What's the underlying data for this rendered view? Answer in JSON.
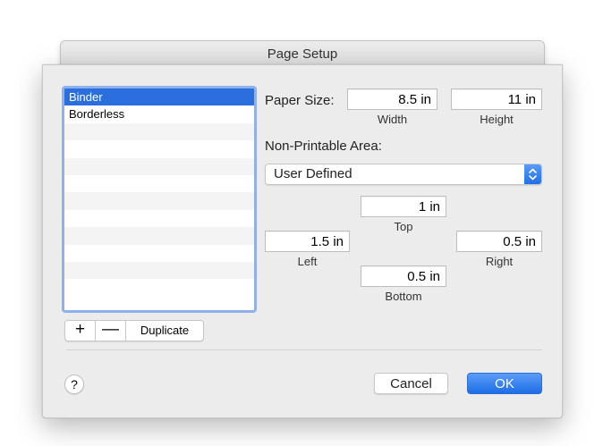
{
  "window": {
    "title": "Page Setup"
  },
  "list": {
    "items": [
      "Binder",
      "Borderless"
    ],
    "selected": "Binder"
  },
  "list_buttons": {
    "add": "+",
    "remove": "—",
    "duplicate": "Duplicate"
  },
  "paper_size": {
    "label": "Paper Size:",
    "width_value": "8.5 in",
    "width_caption": "Width",
    "height_value": "11 in",
    "height_caption": "Height"
  },
  "non_printable": {
    "label": "Non-Printable Area:",
    "preset": "User Defined",
    "top_value": "1 in",
    "top_caption": "Top",
    "left_value": "1.5 in",
    "left_caption": "Left",
    "right_value": "0.5 in",
    "right_caption": "Right",
    "bottom_value": "0.5 in",
    "bottom_caption": "Bottom"
  },
  "footer": {
    "help": "?",
    "cancel": "Cancel",
    "ok": "OK"
  },
  "colors": {
    "selection": "#2b6fde",
    "accent": "#1e6ee7",
    "list_border": "#8fb1eb"
  }
}
